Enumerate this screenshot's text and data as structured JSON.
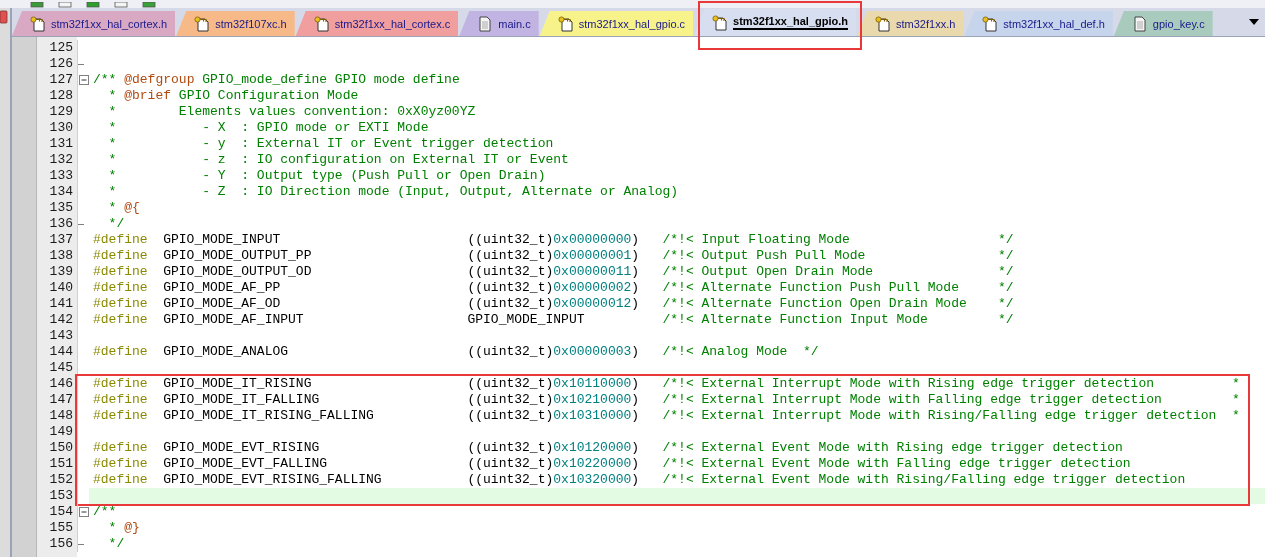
{
  "tabs": [
    {
      "label": "stm32f1xx_hal_cortex.h",
      "kind": "header",
      "color": "#d9a9c4",
      "selected": false,
      "framed": false
    },
    {
      "label": "stm32f107xc.h",
      "kind": "header",
      "color": "#f7b987",
      "selected": false,
      "framed": false
    },
    {
      "label": "stm32f1xx_hal_cortex.c",
      "kind": "header",
      "color": "#f09e9e",
      "selected": false,
      "framed": false
    },
    {
      "label": "main.c",
      "kind": "plain",
      "color": "#c2b4e2",
      "selected": false,
      "framed": false
    },
    {
      "label": "stm32f1xx_hal_gpio.c",
      "kind": "header",
      "color": "#f7f38a",
      "selected": false,
      "framed": false
    },
    {
      "label": "stm32f1xx_hal_gpio.h",
      "kind": "header",
      "color": "#d6def0",
      "selected": true,
      "framed": true
    },
    {
      "label": "stm32f1xx.h",
      "kind": "header",
      "color": "#ead9ac",
      "selected": false,
      "framed": false
    },
    {
      "label": "stm32f1xx_hal_def.h",
      "kind": "header",
      "color": "#c6d5ec",
      "selected": false,
      "framed": false
    },
    {
      "label": "gpio_key.c",
      "kind": "plain",
      "color": "#a8cbbd",
      "selected": false,
      "framed": false
    }
  ],
  "editor": {
    "sections": [
      {
        "framed": false,
        "lines": [
          {
            "number": "125",
            "kind": "plain"
          },
          {
            "number": "126",
            "kind": "fold-end"
          },
          {
            "number": "127",
            "kind": "fold-start",
            "expanded": true,
            "tokens": [
              {
                "kind": "comment",
                "text": "/** "
              },
              {
                "kind": "tag",
                "text": "@defgroup"
              },
              {
                "kind": "comment",
                "text": " GPIO_mode_define GPIO mode define"
              }
            ]
          },
          {
            "number": "128",
            "tokens": [
              {
                "kind": "comment",
                "text": "  * "
              },
              {
                "kind": "tag",
                "text": "@brief"
              },
              {
                "kind": "comment",
                "text": " GPIO Configuration Mode"
              }
            ]
          },
          {
            "number": "129",
            "tokens": [
              {
                "kind": "comment",
                "text": "  *        Elements values convention: 0xX0yz00YZ"
              }
            ]
          },
          {
            "number": "130",
            "tokens": [
              {
                "kind": "comment",
                "text": "  *           - X  : GPIO mode or EXTI Mode"
              }
            ]
          },
          {
            "number": "131",
            "tokens": [
              {
                "kind": "comment",
                "text": "  *           - y  : External IT or Event trigger detection"
              }
            ]
          },
          {
            "number": "132",
            "tokens": [
              {
                "kind": "comment",
                "text": "  *           - z  : IO configuration on External IT or Event"
              }
            ]
          },
          {
            "number": "133",
            "tokens": [
              {
                "kind": "comment",
                "text": "  *           - Y  : Output type (Push Pull or Open Drain)"
              }
            ]
          },
          {
            "number": "134",
            "tokens": [
              {
                "kind": "comment",
                "text": "  *           - Z  : IO Direction mode (Input, Output, Alternate or Analog)"
              }
            ]
          },
          {
            "number": "135",
            "tokens": [
              {
                "kind": "comment",
                "text": "  * "
              },
              {
                "kind": "tag",
                "text": "@{"
              }
            ]
          },
          {
            "number": "136",
            "kind": "fold-end",
            "tokens": [
              {
                "kind": "comment",
                "text": "  */"
              }
            ]
          },
          {
            "number": "137",
            "tokens": [
              {
                "kind": "directive",
                "text": "#define"
              },
              {
                "kind": "text",
                "text": "  GPIO_MODE_INPUT                        ((uint32_t)"
              },
              {
                "kind": "number",
                "text": "0x00000000"
              },
              {
                "kind": "text",
                "text": ")   "
              },
              {
                "kind": "comment",
                "text": "/*!< Input Floating Mode                   */"
              }
            ]
          },
          {
            "number": "138",
            "tokens": [
              {
                "kind": "directive",
                "text": "#define"
              },
              {
                "kind": "text",
                "text": "  GPIO_MODE_OUTPUT_PP                    ((uint32_t)"
              },
              {
                "kind": "number",
                "text": "0x00000001"
              },
              {
                "kind": "text",
                "text": ")   "
              },
              {
                "kind": "comment",
                "text": "/*!< Output Push Pull Mode                 */"
              }
            ]
          },
          {
            "number": "139",
            "tokens": [
              {
                "kind": "directive",
                "text": "#define"
              },
              {
                "kind": "text",
                "text": "  GPIO_MODE_OUTPUT_OD                    ((uint32_t)"
              },
              {
                "kind": "number",
                "text": "0x00000011"
              },
              {
                "kind": "text",
                "text": ")   "
              },
              {
                "kind": "comment",
                "text": "/*!< Output Open Drain Mode                */"
              }
            ]
          },
          {
            "number": "140",
            "tokens": [
              {
                "kind": "directive",
                "text": "#define"
              },
              {
                "kind": "text",
                "text": "  GPIO_MODE_AF_PP                        ((uint32_t)"
              },
              {
                "kind": "number",
                "text": "0x00000002"
              },
              {
                "kind": "text",
                "text": ")   "
              },
              {
                "kind": "comment",
                "text": "/*!< Alternate Function Push Pull Mode     */"
              }
            ]
          },
          {
            "number": "141",
            "tokens": [
              {
                "kind": "directive",
                "text": "#define"
              },
              {
                "kind": "text",
                "text": "  GPIO_MODE_AF_OD                        ((uint32_t)"
              },
              {
                "kind": "number",
                "text": "0x00000012"
              },
              {
                "kind": "text",
                "text": ")   "
              },
              {
                "kind": "comment",
                "text": "/*!< Alternate Function Open Drain Mode    */"
              }
            ]
          },
          {
            "number": "142",
            "tokens": [
              {
                "kind": "directive",
                "text": "#define"
              },
              {
                "kind": "text",
                "text": "  GPIO_MODE_AF_INPUT                     GPIO_MODE_INPUT          "
              },
              {
                "kind": "comment",
                "text": "/*!< Alternate Function Input Mode         */"
              }
            ]
          },
          {
            "number": "143"
          },
          {
            "number": "144",
            "tokens": [
              {
                "kind": "directive",
                "text": "#define"
              },
              {
                "kind": "text",
                "text": "  GPIO_MODE_ANALOG                       ((uint32_t)"
              },
              {
                "kind": "number",
                "text": "0x00000003"
              },
              {
                "kind": "text",
                "text": ")   "
              },
              {
                "kind": "comment",
                "text": "/*!< Analog Mode  */"
              }
            ]
          },
          {
            "number": "145"
          }
        ]
      },
      {
        "framed": true,
        "lines": [
          {
            "number": "146",
            "tokens": [
              {
                "kind": "directive",
                "text": "#define"
              },
              {
                "kind": "text",
                "text": "  GPIO_MODE_IT_RISING                    ((uint32_t)"
              },
              {
                "kind": "number",
                "text": "0x10110000"
              },
              {
                "kind": "text",
                "text": ")   "
              },
              {
                "kind": "comment",
                "text": "/*!< External Interrupt Mode with Rising edge trigger detection          *"
              }
            ]
          },
          {
            "number": "147",
            "tokens": [
              {
                "kind": "directive",
                "text": "#define"
              },
              {
                "kind": "text",
                "text": "  GPIO_MODE_IT_FALLING                   ((uint32_t)"
              },
              {
                "kind": "number",
                "text": "0x10210000"
              },
              {
                "kind": "text",
                "text": ")   "
              },
              {
                "kind": "comment",
                "text": "/*!< External Interrupt Mode with Falling edge trigger detection         *"
              }
            ]
          },
          {
            "number": "148",
            "tokens": [
              {
                "kind": "directive",
                "text": "#define"
              },
              {
                "kind": "text",
                "text": "  GPIO_MODE_IT_RISING_FALLING            ((uint32_t)"
              },
              {
                "kind": "number",
                "text": "0x10310000"
              },
              {
                "kind": "text",
                "text": ")   "
              },
              {
                "kind": "comment",
                "text": "/*!< External Interrupt Mode with Rising/Falling edge trigger detection  *"
              }
            ]
          },
          {
            "number": "149"
          },
          {
            "number": "150",
            "tokens": [
              {
                "kind": "directive",
                "text": "#define"
              },
              {
                "kind": "text",
                "text": "  GPIO_MODE_EVT_RISING                   ((uint32_t)"
              },
              {
                "kind": "number",
                "text": "0x10120000"
              },
              {
                "kind": "text",
                "text": ")   "
              },
              {
                "kind": "comment",
                "text": "/*!< External Event Mode with Rising edge trigger detection"
              }
            ]
          },
          {
            "number": "151",
            "tokens": [
              {
                "kind": "directive",
                "text": "#define"
              },
              {
                "kind": "text",
                "text": "  GPIO_MODE_EVT_FALLING                  ((uint32_t)"
              },
              {
                "kind": "number",
                "text": "0x10220000"
              },
              {
                "kind": "text",
                "text": ")   "
              },
              {
                "kind": "comment",
                "text": "/*!< External Event Mode with Falling edge trigger detection"
              }
            ]
          },
          {
            "number": "152",
            "tokens": [
              {
                "kind": "directive",
                "text": "#define"
              },
              {
                "kind": "text",
                "text": "  GPIO_MODE_EVT_RISING_FALLING           ((uint32_t)"
              },
              {
                "kind": "number",
                "text": "0x10320000"
              },
              {
                "kind": "text",
                "text": ")   "
              },
              {
                "kind": "comment",
                "text": "/*!< External Event Mode with Rising/Falling edge trigger detection"
              }
            ]
          },
          {
            "number": "153",
            "current": true
          }
        ]
      },
      {
        "framed": false,
        "lines": [
          {
            "number": "154",
            "kind": "fold-start",
            "expanded": true,
            "tokens": [
              {
                "kind": "comment",
                "text": "/**"
              }
            ]
          },
          {
            "number": "155",
            "tokens": [
              {
                "kind": "comment",
                "text": "  * "
              },
              {
                "kind": "tag",
                "text": "@}"
              }
            ]
          },
          {
            "number": "156",
            "kind": "fold-end",
            "tokens": [
              {
                "kind": "comment",
                "text": "  */"
              }
            ]
          }
        ]
      }
    ]
  }
}
